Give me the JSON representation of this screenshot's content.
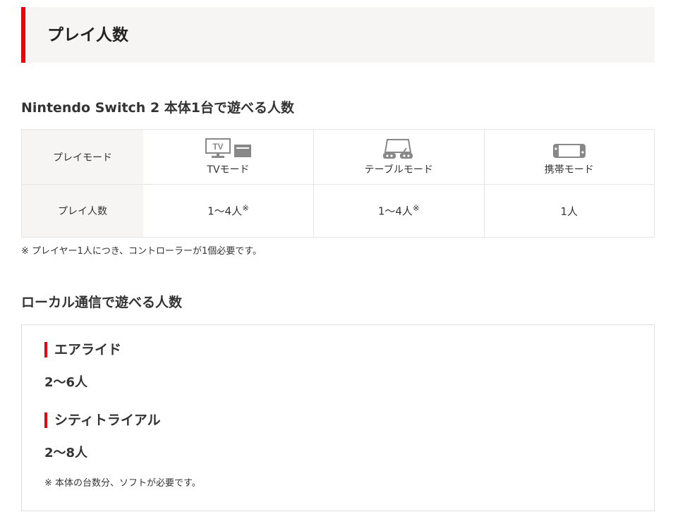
{
  "header": {
    "title": "プレイ人数"
  },
  "section1": {
    "title": "Nintendo Switch 2 本体1台で遊べる人数",
    "table": {
      "row1_label": "プレイモード",
      "row2_label": "プレイ人数",
      "modes": [
        {
          "label": "TVモード",
          "icon": "tv-mode-icon",
          "count": "1〜4人",
          "mark": "※"
        },
        {
          "label": "テーブルモード",
          "icon": "tabletop-mode-icon",
          "count": "1〜4人",
          "mark": "※"
        },
        {
          "label": "携帯モード",
          "icon": "handheld-mode-icon",
          "count": "1人",
          "mark": ""
        }
      ]
    },
    "note": "※ プレイヤー1人につき、コントローラーが1個必要です。"
  },
  "section2": {
    "title": "ローカル通信で遊べる人数",
    "games": [
      {
        "title": "エアライド",
        "count": "2〜6人"
      },
      {
        "title": "シティトライアル",
        "count": "2〜8人"
      }
    ],
    "note": "※ 本体の台数分、ソフトが必要です。"
  },
  "colors": {
    "accent": "#e60012",
    "header_bg": "#f6f5f3",
    "icon_gray": "#888888"
  }
}
